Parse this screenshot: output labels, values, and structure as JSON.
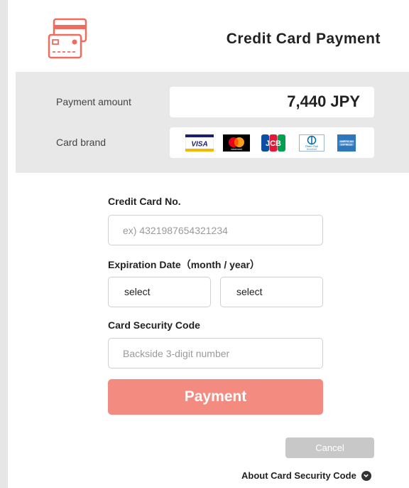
{
  "header": {
    "title": "Credit Card Payment",
    "logo_icon": "credit-card-icon",
    "accent": "#f06b5d"
  },
  "summary": {
    "amount_label": "Payment amount",
    "amount_value": "7,440 JPY",
    "brand_label": "Card brand",
    "brands": [
      "visa-icon",
      "mastercard-icon",
      "jcb-icon",
      "diners-club-icon",
      "american-express-icon"
    ],
    "brand_texts": {
      "visa": "VISA",
      "mastercard": "mastercard",
      "jcb": "JCB",
      "diners": "Diners Club",
      "diners_sub": "International",
      "amex": "AMERICAN EXPRESS"
    }
  },
  "form": {
    "card_no_label": "Credit Card No.",
    "card_no_placeholder": "ex) 4321987654321234",
    "expiry_label": "Expiration Date（month / year）",
    "month_value": "select",
    "year_value": "select",
    "cvc_label": "Card Security Code",
    "cvc_placeholder": "Backside 3-digit number"
  },
  "actions": {
    "pay_label": "Payment",
    "cancel_label": "Cancel",
    "about_label": "About Card Security Code"
  }
}
